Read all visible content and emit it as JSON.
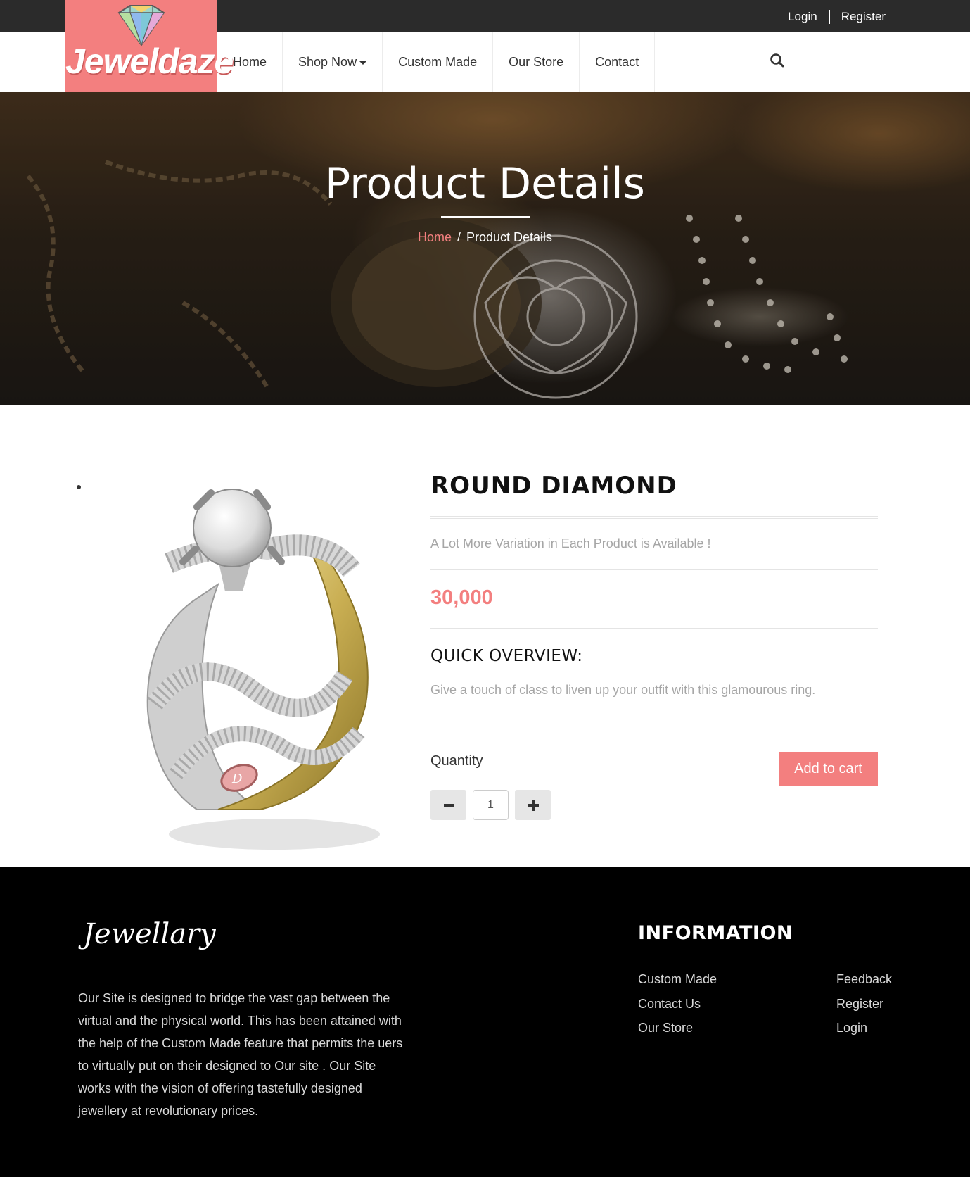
{
  "topbar": {
    "login": "Login",
    "register": "Register"
  },
  "brand": {
    "name": "Jeweldaze"
  },
  "nav": {
    "items": [
      {
        "label": "Home"
      },
      {
        "label": "Shop Now"
      },
      {
        "label": "Custom Made"
      },
      {
        "label": "Our Store"
      },
      {
        "label": "Contact"
      }
    ]
  },
  "hero": {
    "title": "Product Details",
    "breadcrumb": {
      "home": "Home",
      "separator": "/",
      "current": "Product Details"
    }
  },
  "product": {
    "name": "ROUND DIAMOND",
    "subtitle": "A Lot More Variation in Each Product is Available !",
    "price": "30,000",
    "overview_heading": "QUICK OVERVIEW:",
    "overview_text": "Give a touch of class to liven up your outfit with this glamourous ring.",
    "quantity_label": "Quantity",
    "quantity_value": "1",
    "add_to_cart": "Add to cart"
  },
  "footer": {
    "logo": "Jewellary",
    "about": "Our Site is designed to bridge the vast gap between the virtual and the physical world. This has been attained with the help of the Custom Made feature that permits the uers to virtually put on their designed to Our site . Our Site works with the vision of offering tastefully designed jewellery at revolutionary prices.",
    "info_heading": "INFORMATION",
    "links_col1": [
      "Custom Made",
      "Contact Us",
      "Our Store"
    ],
    "links_col2": [
      "Feedback",
      "Register",
      "Login"
    ]
  },
  "colors": {
    "accent": "#f37f7f",
    "topbar": "#2b2b2b",
    "footer": "#000000"
  },
  "icons": {
    "search": "search-icon",
    "minus": "minus-icon",
    "plus": "plus-icon",
    "caret": "caret-down-icon"
  }
}
